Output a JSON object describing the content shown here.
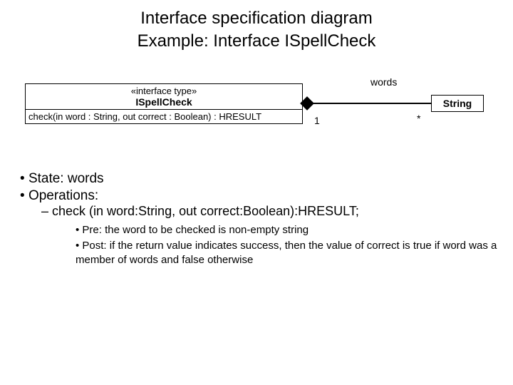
{
  "title": {
    "line1": "Interface specification diagram",
    "line2": "Example: Interface ISpellCheck"
  },
  "diagram": {
    "stereotype": "«interface type»",
    "interface_name": "ISpellCheck",
    "operation": "check(in word : String, out correct : Boolean) : HRESULT",
    "associated_class": "String",
    "role_name": "words",
    "mult_near": "1",
    "mult_far": "*"
  },
  "bullets": {
    "state": "State: words",
    "operations_label": "Operations:",
    "op_signature": "check (in word:String, out correct:Boolean):HRESULT;",
    "pre": "Pre: the word to be checked is non-empty string",
    "post": "Post: if  the return value indicates success, then the value of correct is true if word was a member of words and false otherwise"
  }
}
